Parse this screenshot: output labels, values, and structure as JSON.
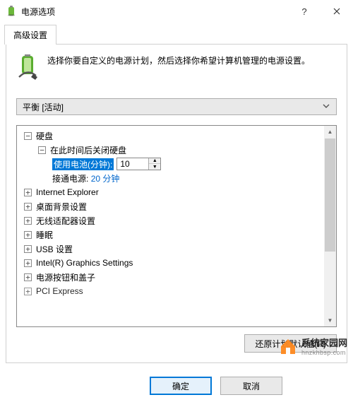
{
  "window": {
    "title": "电源选项"
  },
  "tabs": {
    "advanced": "高级设置"
  },
  "intro": "选择你要自定义的电源计划，然后选择你希望计算机管理的电源设置。",
  "plan_combo": {
    "selected": "平衡 [活动]"
  },
  "tree": {
    "disk": {
      "label": "硬盘",
      "turn_off_after": {
        "label": "在此时间后关闭硬盘",
        "battery_label": "使用电池(分钟):",
        "battery_value": "10",
        "ac_label": "接通电源:",
        "ac_value": "20 分钟"
      }
    },
    "ie": "Internet Explorer",
    "desktop_bg": "桌面背景设置",
    "wifi": "无线适配器设置",
    "sleep": "睡眠",
    "usb": "USB 设置",
    "intel_gfx": "Intel(R) Graphics Settings",
    "power_buttons": "电源按钮和盖子",
    "pci": "PCI Express"
  },
  "buttons": {
    "restore_defaults": "还原计划默认值(R)",
    "ok": "确定",
    "cancel": "取消"
  },
  "watermark": {
    "zh": "系统家园网",
    "en": "hnzkhbsp.com"
  }
}
